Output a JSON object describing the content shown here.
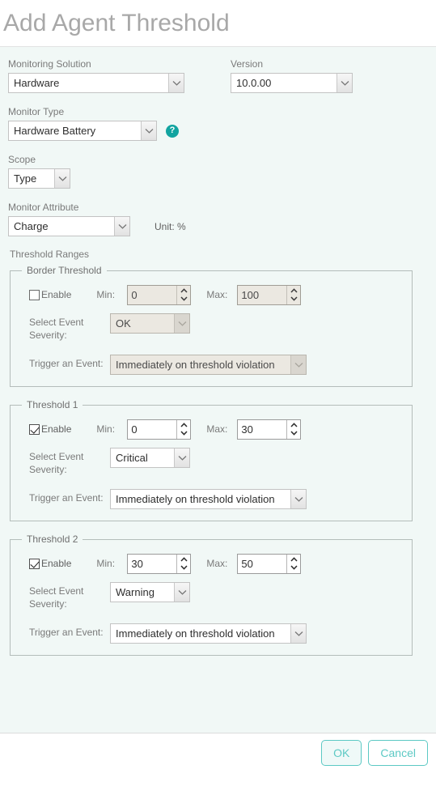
{
  "header": {
    "title": "Add Agent Threshold"
  },
  "form": {
    "monitoring_solution": {
      "label": "Monitoring Solution",
      "value": "Hardware"
    },
    "version": {
      "label": "Version",
      "value": "10.0.00"
    },
    "monitor_type": {
      "label": "Monitor Type",
      "value": "Hardware Battery",
      "help_icon": "help-circle-icon"
    },
    "scope": {
      "label": "Scope",
      "value": "Type"
    },
    "monitor_attribute": {
      "label": "Monitor Attribute",
      "value": "Charge",
      "unit_text": "Unit: %"
    },
    "threshold_ranges_label": "Threshold Ranges",
    "labels": {
      "enable": "Enable",
      "min": "Min:",
      "max": "Max:",
      "severity": "Select Event Severity:",
      "trigger": "Trigger an Event:"
    },
    "groups": [
      {
        "legend": "Border Threshold",
        "enabled": false,
        "min": "0",
        "max": "100",
        "severity": "OK",
        "trigger": "Immediately on threshold violation"
      },
      {
        "legend": "Threshold 1",
        "enabled": true,
        "min": "0",
        "max": "30",
        "severity": "Critical",
        "trigger": "Immediately on threshold violation"
      },
      {
        "legend": "Threshold 2",
        "enabled": true,
        "min": "30",
        "max": "50",
        "severity": "Warning",
        "trigger": "Immediately on threshold violation"
      }
    ]
  },
  "footer": {
    "ok_label": "OK",
    "cancel_label": "Cancel"
  },
  "colors": {
    "accent": "#12A4A0",
    "button_border": "#5cc9c4",
    "body_bg": "#f1f8f6",
    "title": "#a8a8a8"
  }
}
